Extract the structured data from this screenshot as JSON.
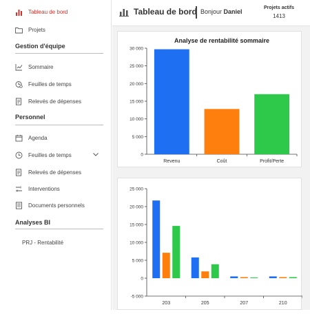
{
  "sidebar": {
    "top_items": [
      {
        "label": "Tableau de bord",
        "icon": "dashboard-icon",
        "active": true
      },
      {
        "label": "Projets",
        "icon": "folder-icon",
        "active": false
      }
    ],
    "sections": [
      {
        "title": "Gestion d'équipe",
        "items": [
          {
            "label": "Sommaire",
            "icon": "summary-chart-icon"
          },
          {
            "label": "Feuilles de temps",
            "icon": "timesheet-icon"
          },
          {
            "label": "Relevés de dépenses",
            "icon": "expense-report-icon"
          }
        ]
      },
      {
        "title": "Personnel",
        "items": [
          {
            "label": "Agenda",
            "icon": "calendar-icon"
          },
          {
            "label": "Feuilles de temps",
            "icon": "clock-icon",
            "expandable": true
          },
          {
            "label": "Relevés de dépenses",
            "icon": "expense-report-icon"
          },
          {
            "label": "Interventions",
            "icon": "interventions-icon"
          },
          {
            "label": "Documents personnels",
            "icon": "document-icon"
          }
        ]
      },
      {
        "title": "Analyses BI",
        "items": [
          {
            "label": "PRJ - Rentabilité",
            "icon": null
          }
        ]
      }
    ]
  },
  "header": {
    "title": "Tableau de bord",
    "greeting": "Bonjour",
    "user_name": "Daniel",
    "projects_label": "Projets actifs",
    "projects_value": "1413"
  },
  "colors": {
    "blue": "#1e6ff1",
    "orange": "#ff7f0e",
    "green": "#2ec94a",
    "active_red": "#d0312d"
  },
  "chart_data": [
    {
      "type": "bar",
      "title": "Analyse de rentabilité sommaire",
      "categories": [
        "Revenu",
        "Coût",
        "Profit/Perte"
      ],
      "values": [
        29700,
        12800,
        17000
      ],
      "colors": [
        "#1e6ff1",
        "#ff7f0e",
        "#2ec94a"
      ],
      "yticks": [
        "0",
        "5 000",
        "10 000",
        "15 000",
        "20 000",
        "25 000",
        "30 000"
      ],
      "ylim": [
        0,
        30000
      ],
      "grid": false
    },
    {
      "type": "bar",
      "title": "",
      "categories": [
        "203",
        "205",
        "207",
        "210"
      ],
      "series": [
        {
          "values": [
            21700,
            5800,
            500,
            500
          ],
          "color": "#1e6ff1"
        },
        {
          "values": [
            7100,
            1900,
            300,
            300
          ],
          "color": "#ff7f0e"
        },
        {
          "values": [
            14600,
            3900,
            200,
            300
          ],
          "color": "#2ec94a"
        }
      ],
      "yticks": [
        "-5 000",
        "0",
        "5 000",
        "10 000",
        "15 000",
        "20 000",
        "25 000"
      ],
      "ylim": [
        -5000,
        25000
      ],
      "grid": false
    }
  ]
}
